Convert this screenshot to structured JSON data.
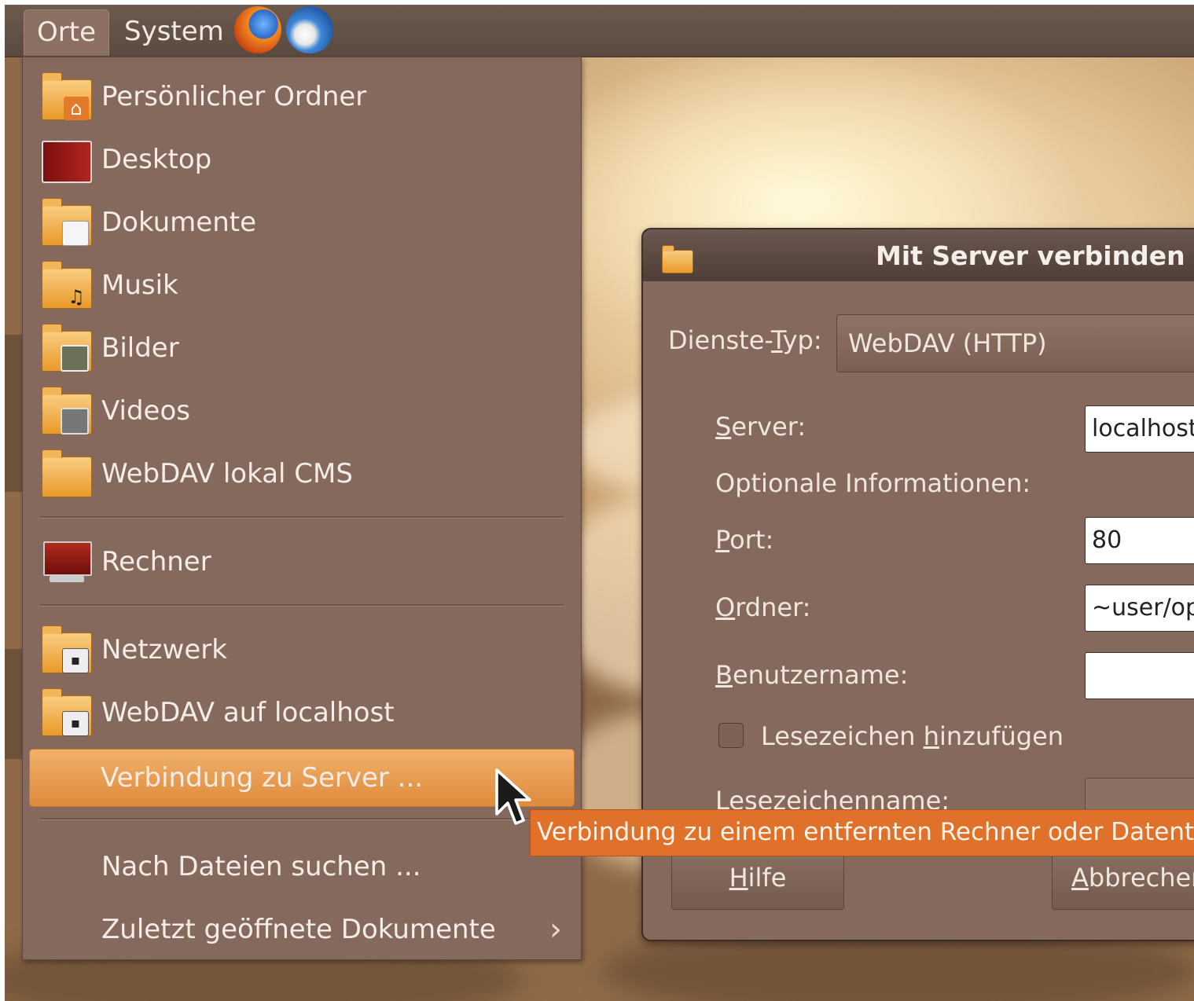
{
  "panel": {
    "menus": [
      "Orte",
      "System"
    ],
    "launchers": [
      "firefox-icon",
      "evolution-mail-icon"
    ]
  },
  "places_menu": {
    "items": [
      {
        "label": "Persönlicher Ordner",
        "icon": "home-folder-icon"
      },
      {
        "label": "Desktop",
        "icon": "desktop-icon"
      },
      {
        "label": "Dokumente",
        "icon": "documents-folder-icon"
      },
      {
        "label": "Musik",
        "icon": "music-folder-icon"
      },
      {
        "label": "Bilder",
        "icon": "pictures-folder-icon"
      },
      {
        "label": "Videos",
        "icon": "videos-folder-icon"
      },
      {
        "label": "WebDAV lokal CMS",
        "icon": "folder-icon"
      },
      {
        "label": "Rechner",
        "icon": "computer-icon"
      },
      {
        "label": "Netzwerk",
        "icon": "network-folder-icon"
      },
      {
        "label": "WebDAV auf localhost",
        "icon": "remote-folder-icon"
      },
      {
        "label": "Verbindung zu Server ...",
        "highlighted": true
      },
      {
        "label": "Nach Dateien suchen ..."
      },
      {
        "label": "Zuletzt geöffnete Dokumente",
        "submenu": true
      }
    ]
  },
  "dialog": {
    "title": "Mit Server verbinden",
    "service_type_label": "Dienste-Typ:",
    "service_type_value": "WebDAV (HTTP)",
    "server_label": "Server:",
    "server_value": "localhost",
    "optional_heading": "Optionale Informationen:",
    "port_label": "Port:",
    "port_value": "80",
    "folder_label": "Ordner:",
    "folder_value": "~user/op",
    "username_label": "Benutzername:",
    "username_value": "",
    "bookmark_checkbox_label": "Lesezeichen hinzufügen",
    "bookmark_checked": false,
    "bookmark_name_label": "Lesezeichenname:",
    "help_button": "Hilfe",
    "cancel_button": "Abbrechen"
  },
  "tooltip": {
    "text": "Verbindung zu einem entfernten Rechner oder Datenträger herstellen"
  },
  "colors": {
    "menu_bg": "#86695d",
    "highlight": "#e8994d",
    "tooltip_bg": "#e0712a",
    "panel_bg": "#5f4e43"
  }
}
